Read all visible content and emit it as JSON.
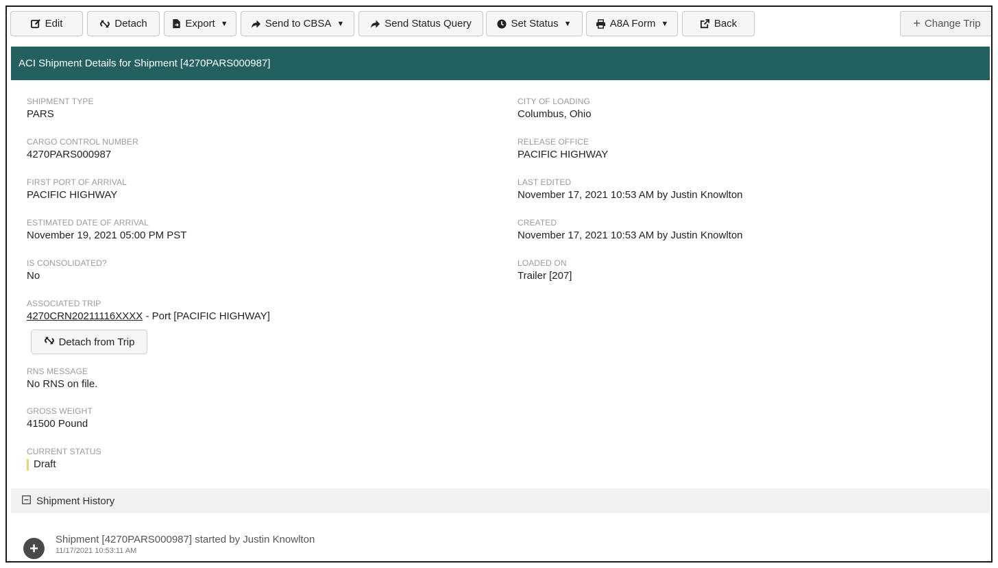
{
  "toolbar": {
    "edit": "Edit",
    "detach": "Detach",
    "export": "Export",
    "send_cbsa": "Send to CBSA",
    "send_status_query": "Send Status Query",
    "set_status": "Set Status",
    "a8a_form": "A8A Form",
    "back": "Back",
    "change_trip": "Change Trip"
  },
  "header": {
    "title": "ACI Shipment Details for Shipment [4270PARS000987]"
  },
  "left_fields": [
    {
      "label": "Shipment Type",
      "value": "PARS"
    },
    {
      "label": "Cargo Control Number",
      "value": "4270PARS000987"
    },
    {
      "label": "First Port of Arrival",
      "value": "PACIFIC HIGHWAY"
    },
    {
      "label": "Estimated Date of Arrival",
      "value": "November 19, 2021 05:00 PM PST"
    },
    {
      "label": "Is Consolidated?",
      "value": "No"
    }
  ],
  "associated_trip": {
    "label": "Associated Trip",
    "link": "4270CRN20211116XXXX",
    "suffix": " - Port [PACIFIC HIGHWAY]",
    "detach_button": "Detach from Trip"
  },
  "rns": {
    "label": "RNS Message",
    "value": "No RNS on file."
  },
  "gross_weight": {
    "label": "Gross Weight",
    "value": "41500 Pound"
  },
  "current_status": {
    "label": "Current Status",
    "value": "Draft",
    "color": "#f0d36b"
  },
  "right_fields": [
    {
      "label": "City of Loading",
      "value": "Columbus, Ohio"
    },
    {
      "label": "Release Office",
      "value": "PACIFIC HIGHWAY"
    },
    {
      "label": "Last Edited",
      "value": "November 17, 2021 10:53 AM by Justin Knowlton"
    },
    {
      "label": "Created",
      "value": "November 17, 2021 10:53 AM by Justin Knowlton"
    },
    {
      "label": "Loaded On",
      "value": "Trailer [207]"
    }
  ],
  "history": {
    "title": "Shipment History",
    "items": [
      {
        "text": "Shipment [4270PARS000987] started by Justin Knowlton",
        "time": "11/17/2021 10:53:11 AM",
        "icon": "plus-icon"
      }
    ]
  },
  "colors": {
    "header_bg": "#236161",
    "status_draft": "#f0d36b"
  }
}
